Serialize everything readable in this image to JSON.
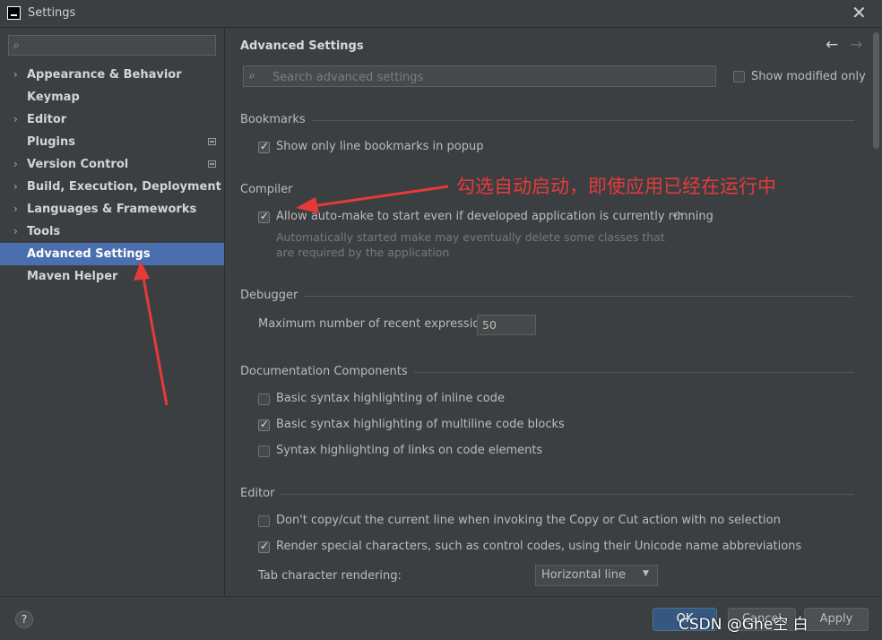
{
  "window": {
    "title": "Settings",
    "close_label": "✕"
  },
  "sidebar": {
    "search_placeholder": "",
    "items": [
      {
        "label": "Appearance & Behavior",
        "expandable": true
      },
      {
        "label": "Keymap",
        "expandable": false
      },
      {
        "label": "Editor",
        "expandable": true
      },
      {
        "label": "Plugins",
        "expandable": false,
        "badge": true
      },
      {
        "label": "Version Control",
        "expandable": true,
        "badge": true
      },
      {
        "label": "Build, Execution, Deployment",
        "expandable": true
      },
      {
        "label": "Languages & Frameworks",
        "expandable": true
      },
      {
        "label": "Tools",
        "expandable": true
      },
      {
        "label": "Advanced Settings",
        "expandable": false,
        "selected": true
      },
      {
        "label": "Maven Helper",
        "expandable": false
      }
    ]
  },
  "main": {
    "title": "Advanced Settings",
    "search_placeholder": "Search advanced settings",
    "show_modified_only": {
      "label": "Show modified only",
      "checked": false
    },
    "bookmarks": {
      "header": "Bookmarks",
      "options": [
        {
          "label": "Show only line bookmarks in popup",
          "checked": true
        }
      ]
    },
    "compiler": {
      "header": "Compiler",
      "option": {
        "label": "Allow auto-make to start even if developed application is currently running",
        "checked": true
      },
      "hint_line1": "Automatically started make may eventually delete some classes that",
      "hint_line2": "are required by the application"
    },
    "debugger": {
      "header": "Debugger",
      "field_label": "Maximum number of recent expressions:",
      "field_value": "50"
    },
    "documentation": {
      "header": "Documentation Components",
      "options": [
        {
          "label": "Basic syntax highlighting of inline code",
          "checked": false
        },
        {
          "label": "Basic syntax highlighting of multiline code blocks",
          "checked": true
        },
        {
          "label": "Syntax highlighting of links on code elements",
          "checked": false
        }
      ]
    },
    "editor": {
      "header": "Editor",
      "options": [
        {
          "label": "Don't copy/cut the current line when invoking the Copy or Cut action with no selection",
          "checked": false
        },
        {
          "label": "Render special characters, such as control codes, using their Unicode name abbreviations",
          "checked": true
        }
      ],
      "tab_label": "Tab character rendering:",
      "tab_value": "Horizontal line"
    }
  },
  "annotation": {
    "text": "勾选自动启动，即使应用已经在运行中",
    "color": "#e63a3a"
  },
  "footer": {
    "help_label": "?",
    "ok_label": "OK",
    "cancel_label": "Cancel",
    "apply_label": "Apply"
  },
  "watermark": "CSDN @Ghe空 白",
  "colors": {
    "background": "#3c3f41",
    "selected": "#4b6eaf",
    "primary_button": "#365880",
    "text": "#bbbbbb"
  }
}
